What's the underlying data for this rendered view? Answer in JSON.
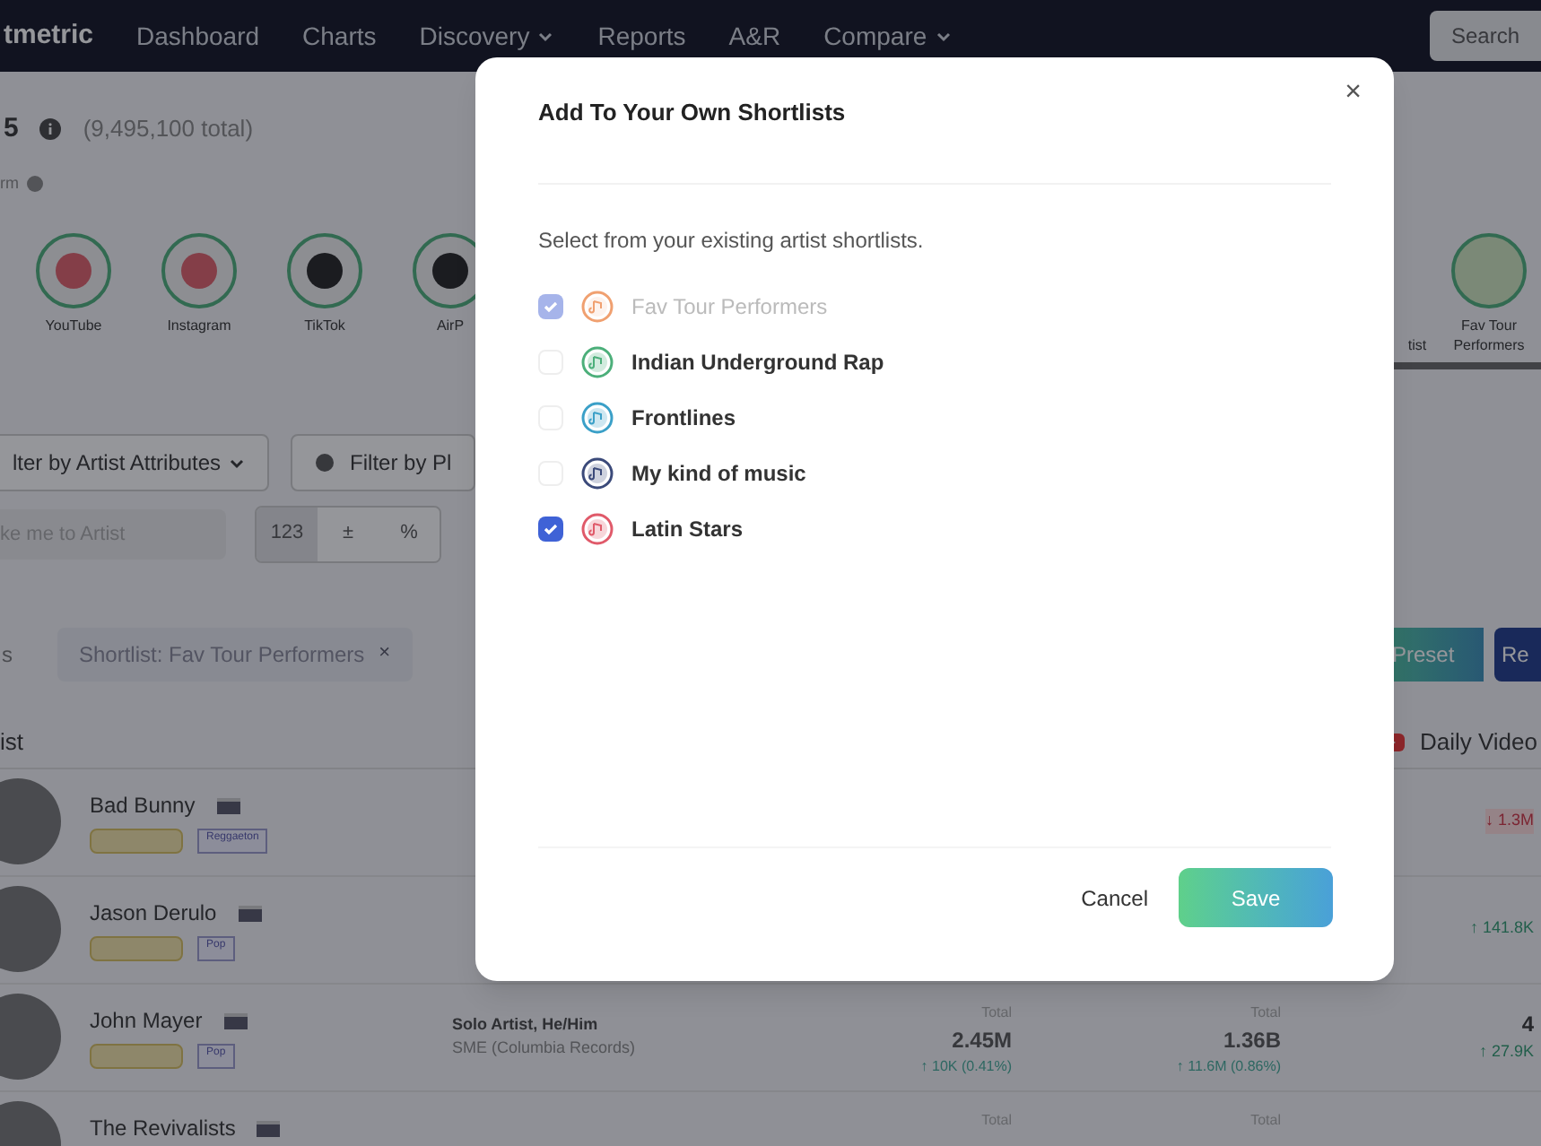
{
  "nav": {
    "brand": "tmetric",
    "items": [
      {
        "label": "Dashboard",
        "dropdown": false
      },
      {
        "label": "Charts",
        "dropdown": false
      },
      {
        "label": "Discovery",
        "dropdown": true
      },
      {
        "label": "Reports",
        "dropdown": false
      },
      {
        "label": "A&R",
        "dropdown": false
      },
      {
        "label": "Compare",
        "dropdown": true
      }
    ],
    "search": {
      "placeholder": "Search"
    }
  },
  "header": {
    "count": "5",
    "total": "(9,495,100 total)"
  },
  "platforms": {
    "label": "rm",
    "items": [
      {
        "label": "YouTube"
      },
      {
        "label": "Instagram"
      },
      {
        "label": "TikTok"
      },
      {
        "label": "AirP"
      }
    ],
    "right_items": [
      {
        "label": "tist"
      },
      {
        "label": "Fav Tour Performers"
      }
    ]
  },
  "filters": {
    "buttons": [
      {
        "label": "lter by Artist Attributes",
        "dropdown": true
      },
      {
        "label": "Filter by Pl",
        "dropdown": false
      }
    ],
    "input": {
      "placeholder": "ke me to Artist"
    },
    "segments": [
      {
        "label": "123",
        "selected": true
      },
      {
        "label": "±",
        "selected": false
      },
      {
        "label": "%",
        "selected": false
      }
    ]
  },
  "chips": {
    "left": "s",
    "items": [
      {
        "label": "Shortlist: Fav Tour Performers",
        "close": "×"
      }
    ]
  },
  "actions": [
    {
      "label": "Preset",
      "kind": "gradient"
    },
    {
      "label": "Re",
      "kind": "solid"
    }
  ],
  "table": {
    "columns": [
      {
        "label": "ist"
      },
      {
        "label": "Daily Video"
      }
    ],
    "rows": [
      {
        "name": "Bad Bunny",
        "tags": [
          "Reggaeton"
        ],
        "info": [],
        "cells": [],
        "right": {
          "change": "↓ 1.3M",
          "up": false
        }
      },
      {
        "name": "Jason Derulo",
        "tags": [
          "Pop"
        ],
        "info": [],
        "cells": [],
        "right": {
          "change": "↑ 141.8K",
          "up": true
        }
      },
      {
        "name": "John Mayer",
        "tags": [
          "Pop"
        ],
        "info": [
          "Solo Artist, He/Him",
          "SME (Columbia Records)"
        ],
        "cells": [
          {
            "label": "Total",
            "value": "2.45M",
            "change": "↑ 10K (0.41%)"
          },
          {
            "label": "Total",
            "value": "1.36B",
            "change": "↑ 11.6M (0.86%)"
          }
        ],
        "right": {
          "value": "4",
          "change": "↑ 27.9K",
          "up": true
        }
      },
      {
        "name": "The Revivalists",
        "tags": [],
        "info": [],
        "cells": [
          {
            "label": "Total"
          },
          {
            "label": "Total"
          }
        ]
      }
    ]
  },
  "modal": {
    "title": "Add To Your Own Shortlists",
    "close": "×",
    "subtitle": "Select from your existing artist shortlists.",
    "shortlists": [
      {
        "label": "Fav Tour Performers",
        "checked": true,
        "disabled": true,
        "color": "#f0a070"
      },
      {
        "label": "Indian Underground Rap",
        "checked": false,
        "disabled": false,
        "color": "#4caf7a"
      },
      {
        "label": "Frontlines",
        "checked": false,
        "disabled": false,
        "color": "#3ba0c8"
      },
      {
        "label": "My kind of music",
        "checked": false,
        "disabled": false,
        "color": "#3b4a7a"
      },
      {
        "label": "Latin Stars",
        "checked": true,
        "disabled": false,
        "color": "#e05a6a"
      }
    ],
    "cancel": "Cancel",
    "save": "Save"
  }
}
